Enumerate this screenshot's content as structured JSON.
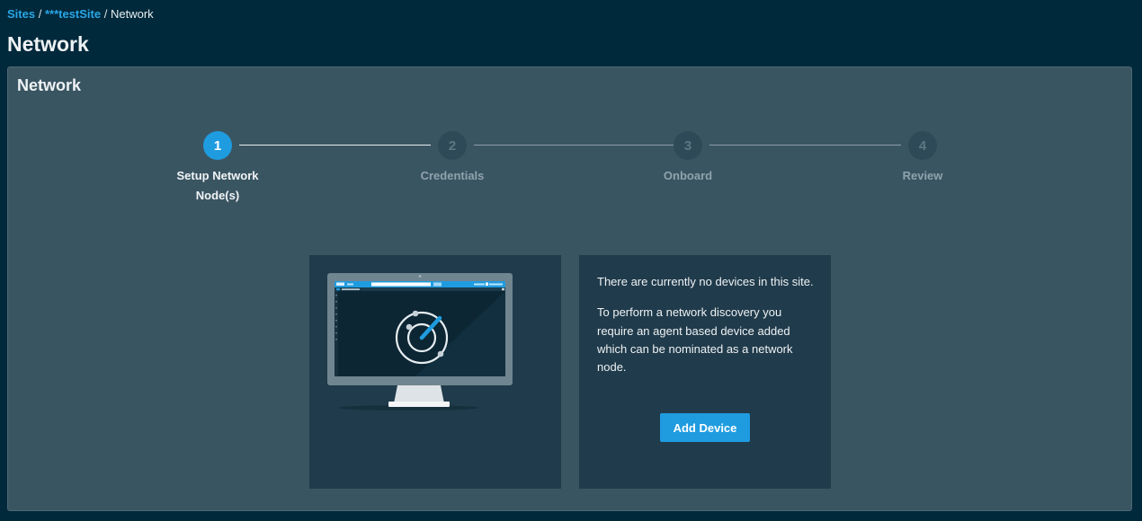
{
  "breadcrumb": {
    "items": [
      {
        "label": "Sites"
      },
      {
        "label": "***testSite"
      },
      {
        "label": "Network"
      }
    ],
    "separator": "/"
  },
  "page": {
    "title": "Network"
  },
  "card": {
    "title": "Network"
  },
  "stepper": {
    "current_step": 1,
    "steps": [
      {
        "number": "1",
        "label": "Setup Network Node(s)",
        "state": "active"
      },
      {
        "number": "2",
        "label": "Credentials",
        "state": "inactive"
      },
      {
        "number": "3",
        "label": "Onboard",
        "state": "inactive"
      },
      {
        "number": "4",
        "label": "Review",
        "state": "inactive"
      }
    ]
  },
  "illustration": {
    "icon": "monitor-network-scan-illustration"
  },
  "empty_state": {
    "message": "There are currently no devices in this site.",
    "description": "To perform a network discovery you require an agent based device added which can be nominated as a network node.",
    "add_button_label": "Add Device"
  },
  "colors": {
    "background": "#00293b",
    "card": "#3a5562",
    "panel": "#203b4b",
    "accent": "#1f9ce0",
    "link": "#2aa6e6"
  }
}
